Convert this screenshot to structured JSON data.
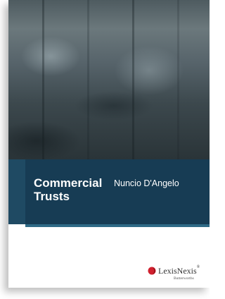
{
  "book": {
    "title_line1": "Commercial",
    "title_line2": "Trusts",
    "author": "Nuncio D'Angelo"
  },
  "publisher": {
    "name": "LexisNexis",
    "name_mark": "®",
    "imprint": "Butterworths",
    "logo_icon": "lexisnexis-logo-icon"
  },
  "colors": {
    "band": "#173c54",
    "band_stripe": "#2f6a86",
    "logo_red": "#d0202e"
  }
}
